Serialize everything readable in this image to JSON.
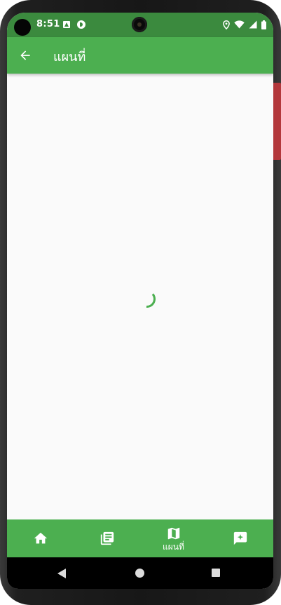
{
  "status_bar": {
    "time": "8:51"
  },
  "app_bar": {
    "title": "แผนที่",
    "back_icon": "arrow-back-icon"
  },
  "content": {
    "loading_indicator": "circular-progress"
  },
  "bottom_nav": {
    "items": [
      {
        "icon": "home-icon",
        "label": ""
      },
      {
        "icon": "library-books-icon",
        "label": ""
      },
      {
        "icon": "map-icon",
        "label": "แผนที่",
        "active": true
      },
      {
        "icon": "feedback-icon",
        "label": ""
      }
    ]
  },
  "colors": {
    "status_bar": "#3b8a3e",
    "primary": "#4caf50",
    "background": "#fafafa",
    "on_primary": "#ffffff"
  }
}
